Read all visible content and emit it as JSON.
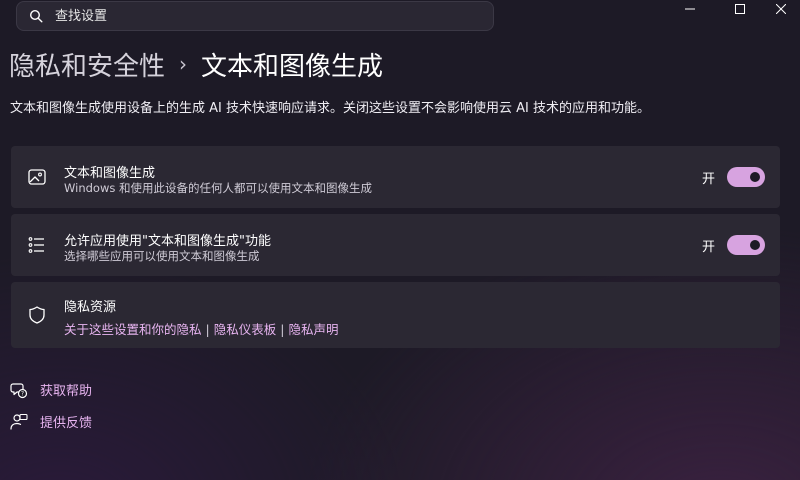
{
  "search": {
    "placeholder": "查找设置"
  },
  "window_controls": [
    "minimize-icon",
    "maximize-icon",
    "close-icon"
  ],
  "breadcrumb": {
    "parent": "隐私和安全性",
    "separator": "›",
    "current": "文本和图像生成"
  },
  "description": "文本和图像生成使用设备上的生成 AI 技术快速响应请求。关闭这些设置不会影响使用云 AI 技术的应用和功能。",
  "cards": [
    {
      "icon": "image-icon",
      "title": "文本和图像生成",
      "subtitle": "Windows 和使用此设备的任何人都可以使用文本和图像生成",
      "state_label": "开",
      "toggle_on": true
    },
    {
      "icon": "list-icon",
      "title": "允许应用使用\"文本和图像生成\"功能",
      "subtitle": "选择哪些应用可以使用文本和图像生成",
      "state_label": "开",
      "toggle_on": true
    },
    {
      "icon": "shield-icon",
      "title": "隐私资源",
      "links": [
        "关于这些设置和你的隐私",
        "隐私仪表板",
        "隐私声明"
      ],
      "link_separator": "|"
    }
  ],
  "help_links": [
    {
      "icon": "help-icon",
      "label": "获取帮助"
    },
    {
      "icon": "feedback-icon",
      "label": "提供反馈"
    }
  ],
  "colors": {
    "accent": "#d7a3e0",
    "link": "#e7b4f0",
    "card_bg": "#2b2833",
    "background": "#1d1a26"
  }
}
